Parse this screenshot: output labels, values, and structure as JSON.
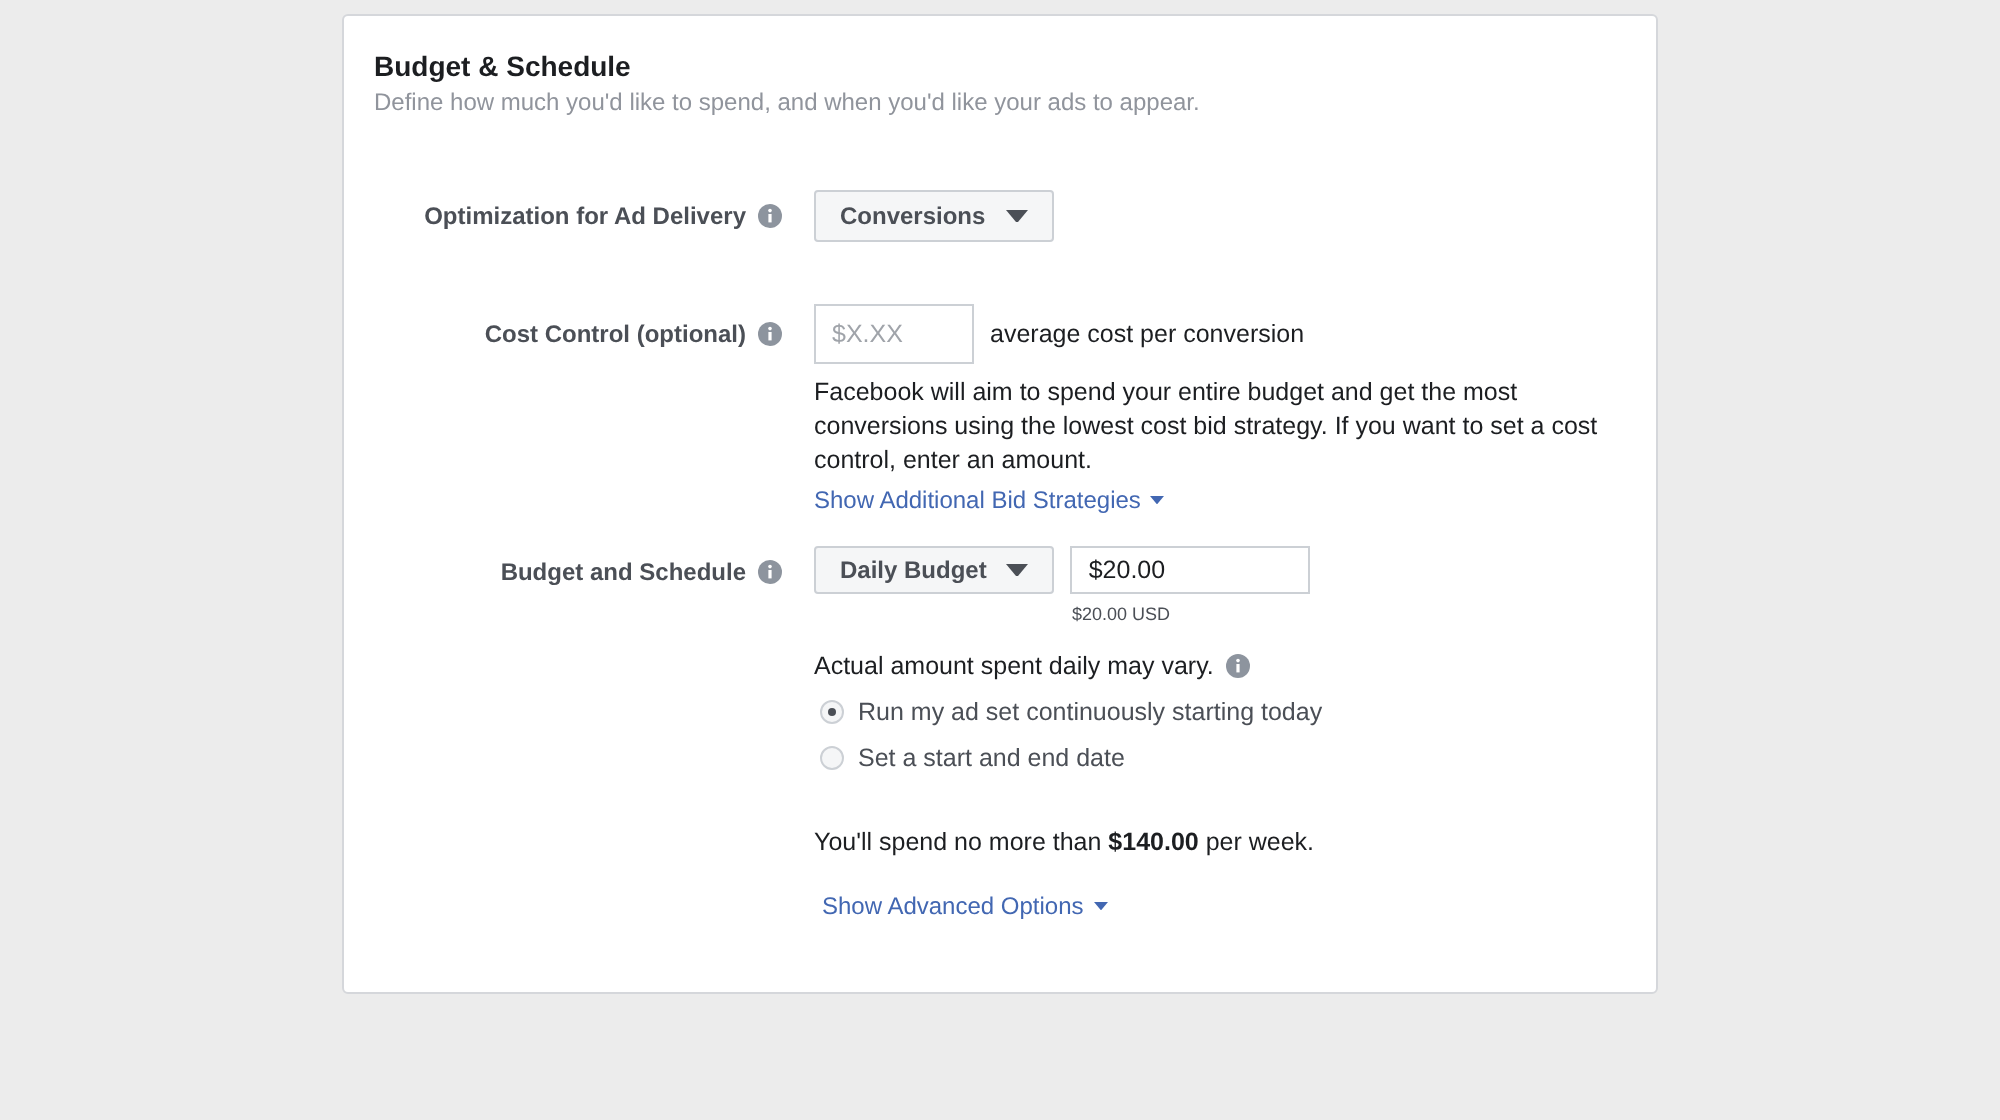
{
  "card": {
    "title": "Budget & Schedule",
    "subtitle": "Define how much you'd like to spend, and when you'd like your ads to appear."
  },
  "optimization": {
    "label": "Optimization for Ad Delivery",
    "dropdown": "Conversions"
  },
  "cost_control": {
    "label": "Cost Control (optional)",
    "placeholder": "$X.XX",
    "suffix": "average cost per conversion",
    "help": "Facebook will aim to spend your entire budget and get the most conversions using the lowest cost bid strategy. If you want to set a cost control, enter an amount.",
    "link": "Show Additional Bid Strategies"
  },
  "budget": {
    "label": "Budget and Schedule",
    "dropdown": "Daily Budget",
    "value": "$20.00",
    "converted": "$20.00 USD",
    "note": "Actual amount spent daily may vary.",
    "options": [
      {
        "label": "Run my ad set continuously starting today",
        "selected": true
      },
      {
        "label": "Set a start and end date",
        "selected": false
      }
    ],
    "summary": "You'll spend no more than **$140.00** per week.",
    "link": "Show Advanced Options"
  }
}
